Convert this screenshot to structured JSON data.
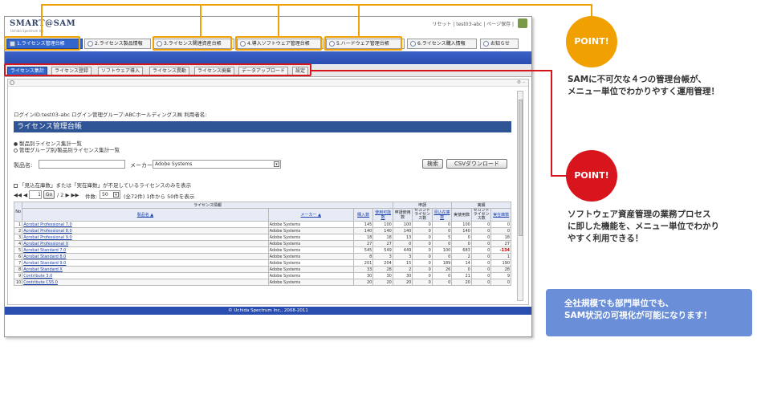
{
  "app": {
    "logo": "SMART@SAM",
    "logo_sub": "Uchida Spectrum Inc",
    "top_links": "リセット | test03-abc | ページ保存 |"
  },
  "nav_tabs": [
    {
      "label": "1.ライセンス管理台帳",
      "active": true
    },
    {
      "label": "2.ライセンス製品情報",
      "active": false
    },
    {
      "label": "3.ライセンス関連資産台帳",
      "active": false
    },
    {
      "label": "4.導入ソフトウェア管理台帳",
      "active": false
    },
    {
      "label": "5.ハードウェア管理台帳",
      "active": false
    },
    {
      "label": "6.ライセンス購入情報",
      "active": false
    },
    {
      "label": "お知らせ",
      "active": false
    }
  ],
  "sub_tabs": [
    {
      "label": "ライセンス集計",
      "active": true
    },
    {
      "label": "ライセンス登録",
      "active": false
    },
    {
      "label": "ソフトウェア導入",
      "active": false
    },
    {
      "label": "ライセンス異動",
      "active": false
    },
    {
      "label": "ライセンス廃棄",
      "active": false
    },
    {
      "label": "データアップロード",
      "active": false
    },
    {
      "label": "設定",
      "active": false
    }
  ],
  "pane": {
    "controls": "⚙ –",
    "login_info": "ログインID:test03-abc   ログイン管理グループ:ABCホールディングス㈱   利用者名:",
    "title": "ライセンス管理台帳",
    "radio_options": [
      {
        "label": "製品別ライセンス集計一覧",
        "checked": true
      },
      {
        "label": "管理グループ別/製品別ライセンス集計一覧",
        "checked": false
      }
    ],
    "product_label": "製品名:",
    "product_value": "",
    "maker_label": "メーカー:",
    "maker_value": "Adobe Systems",
    "search_button": "検索",
    "csv_button": "CSVダウンロード",
    "filter_checkbox": "「見込在庫数」または「実在庫数」が不足しているライセンスのみを表示",
    "pagination": {
      "first_prev": "◀◀ ◀",
      "page": "1",
      "go": "Go",
      "total_pages": "/ 2 ▶ ▶▶",
      "count_label": "件数:",
      "per_page": "50",
      "summary": "(全72件)  1件から 50件を表示"
    }
  },
  "table": {
    "group_header": "ライセンス情報",
    "group_apply": "申請",
    "group_actual": "実績",
    "col_no": "No",
    "col_product": "製品名 ▲",
    "col_maker": "メーカー ▲",
    "col_purchase": "購入数",
    "col_usable": "使用可能数",
    "col_apply_use": "申請使用数",
    "col_apply_lic": "セカンドライセンス数",
    "col_expected": "見込在庫数",
    "col_actual_use": "実使用数",
    "col_actual_lic": "セカンドライセンス数",
    "col_actual_stock": "実在庫数",
    "rows": [
      {
        "no": "1",
        "product": "Acrobat Professional 7.0",
        "maker": "Adobe Systems",
        "v": [
          "145",
          "100",
          "100",
          "0",
          "0",
          "100",
          "0",
          "0"
        ]
      },
      {
        "no": "2",
        "product": "Acrobat Professional 8.0",
        "maker": "Adobe Systems",
        "v": [
          "140",
          "140",
          "140",
          "0",
          "0",
          "140",
          "0",
          "0"
        ]
      },
      {
        "no": "3",
        "product": "Acrobat Professional 9.0",
        "maker": "Adobe Systems",
        "v": [
          "18",
          "18",
          "13",
          "0",
          "5",
          "0",
          "0",
          "18"
        ]
      },
      {
        "no": "4",
        "product": "Acrobat Professional X",
        "maker": "Adobe Systems",
        "v": [
          "27",
          "27",
          "0",
          "0",
          "0",
          "0",
          "0",
          "27"
        ]
      },
      {
        "no": "5",
        "product": "Acrobat Standard 7.0",
        "maker": "Adobe Systems",
        "v": [
          "545",
          "549",
          "449",
          "0",
          "100",
          "683",
          "0",
          "-134"
        ]
      },
      {
        "no": "6",
        "product": "Acrobat Standard 8.0",
        "maker": "Adobe Systems",
        "v": [
          "8",
          "3",
          "3",
          "0",
          "0",
          "2",
          "0",
          "1"
        ]
      },
      {
        "no": "7",
        "product": "Acrobat Standard 9.0",
        "maker": "Adobe Systems",
        "v": [
          "201",
          "204",
          "15",
          "0",
          "189",
          "14",
          "0",
          "190"
        ]
      },
      {
        "no": "8",
        "product": "Acrobat Standard X",
        "maker": "Adobe Systems",
        "v": [
          "33",
          "28",
          "2",
          "0",
          "26",
          "0",
          "0",
          "28"
        ]
      },
      {
        "no": "9",
        "product": "Contribute 3.0",
        "maker": "Adobe Systems",
        "v": [
          "30",
          "30",
          "30",
          "0",
          "0",
          "21",
          "0",
          "9"
        ]
      },
      {
        "no": "10",
        "product": "Contribute CS5.0",
        "maker": "Adobe Systems",
        "v": [
          "20",
          "20",
          "20",
          "0",
          "0",
          "20",
          "0",
          "0"
        ]
      }
    ]
  },
  "footer": "© Uchida Spectrum Inc., 2008-2011",
  "callouts": {
    "point1_badge": "POINT!",
    "point1_text": [
      "SAMに不可欠な４つの管理台帳が、",
      "メニュー単位でわかりやすく運用管理！"
    ],
    "point2_badge": "POINT!",
    "point2_text": [
      "ソフトウェア資産管理の業務プロセス",
      "に即した機能を、メニュー単位でわかり",
      "やすく利用できる！"
    ],
    "info_box": [
      "全社規模でも部門単位でも、",
      "SAM状況の可視化が可能になります！"
    ]
  },
  "colors": {
    "orange": "#f0a000",
    "red": "#d8141c",
    "brand_blue": "#2a4eb0",
    "info_blue": "#6a8fd8"
  }
}
